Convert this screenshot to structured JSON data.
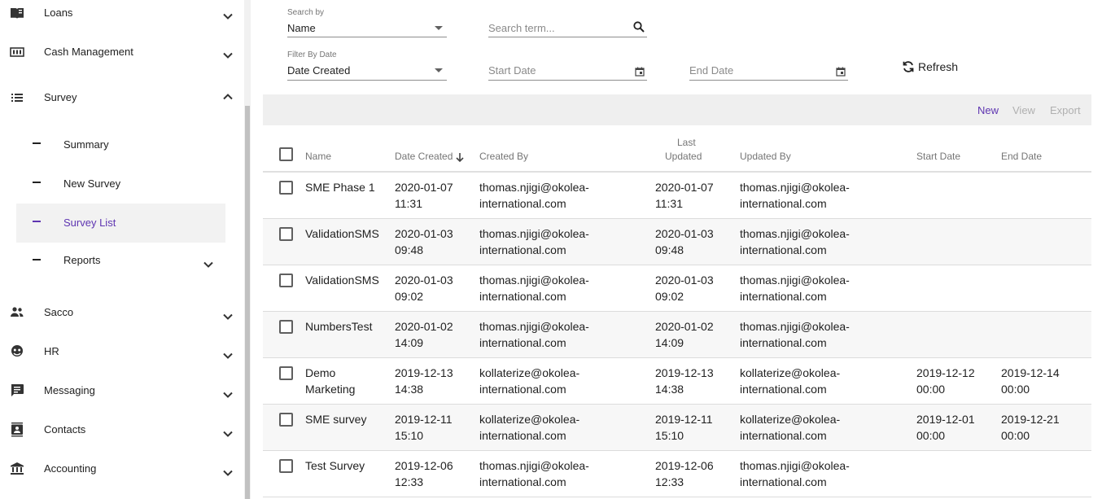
{
  "sidebar": {
    "items": [
      {
        "name": "loans",
        "label": "Loans",
        "icon": "book-icon",
        "expanded": false
      },
      {
        "name": "cash-management",
        "label": "Cash Management",
        "icon": "money-icon",
        "expanded": false
      },
      {
        "name": "survey",
        "label": "Survey",
        "icon": "list-icon",
        "expanded": true
      },
      {
        "name": "sacco",
        "label": "Sacco",
        "icon": "people-icon",
        "expanded": false
      },
      {
        "name": "hr",
        "label": "HR",
        "icon": "face-icon",
        "expanded": false
      },
      {
        "name": "messaging",
        "label": "Messaging",
        "icon": "message-icon",
        "expanded": false
      },
      {
        "name": "contacts",
        "label": "Contacts",
        "icon": "contacts-icon",
        "expanded": false
      },
      {
        "name": "accounting",
        "label": "Accounting",
        "icon": "bank-icon",
        "expanded": false
      }
    ],
    "survey_sub": [
      {
        "label": "Summary",
        "active": false
      },
      {
        "label": "New Survey",
        "active": false
      },
      {
        "label": "Survey List",
        "active": true
      },
      {
        "label": "Reports",
        "active": false,
        "has_children": true
      }
    ]
  },
  "filters": {
    "search_by_label": "Search by",
    "search_by_value": "Name",
    "search_placeholder": "Search term...",
    "filter_by_date_label": "Filter By Date",
    "filter_by_date_value": "Date Created",
    "start_date_placeholder": "Start Date",
    "end_date_placeholder": "End Date",
    "refresh_label": "Refresh"
  },
  "toolbar": {
    "new_label": "New",
    "view_label": "View",
    "export_label": "Export"
  },
  "table": {
    "headers": {
      "name": "Name",
      "date_created": "Date Created",
      "created_by": "Created By",
      "last_updated_1": "Last",
      "last_updated_2": "Updated",
      "updated_by": "Updated By",
      "start_date": "Start Date",
      "end_date": "End Date"
    },
    "rows": [
      {
        "name": [
          "SME Phase 1",
          ""
        ],
        "date_created": [
          "2020-01-07",
          "11:31"
        ],
        "created_by": [
          "thomas.njigi@okolea-",
          "international.com"
        ],
        "last_updated": [
          "2020-01-07",
          "11:31"
        ],
        "updated_by": [
          "thomas.njigi@okolea-",
          "international.com"
        ],
        "start_date": [
          "",
          ""
        ],
        "end_date": [
          "",
          ""
        ]
      },
      {
        "name": [
          "ValidationSMS",
          ""
        ],
        "date_created": [
          "2020-01-03",
          "09:48"
        ],
        "created_by": [
          "thomas.njigi@okolea-",
          "international.com"
        ],
        "last_updated": [
          "2020-01-03",
          "09:48"
        ],
        "updated_by": [
          "thomas.njigi@okolea-",
          "international.com"
        ],
        "start_date": [
          "",
          ""
        ],
        "end_date": [
          "",
          ""
        ]
      },
      {
        "name": [
          "ValidationSMS",
          ""
        ],
        "date_created": [
          "2020-01-03",
          "09:02"
        ],
        "created_by": [
          "thomas.njigi@okolea-",
          "international.com"
        ],
        "last_updated": [
          "2020-01-03",
          "09:02"
        ],
        "updated_by": [
          "thomas.njigi@okolea-",
          "international.com"
        ],
        "start_date": [
          "",
          ""
        ],
        "end_date": [
          "",
          ""
        ]
      },
      {
        "name": [
          "NumbersTest",
          ""
        ],
        "date_created": [
          "2020-01-02",
          "14:09"
        ],
        "created_by": [
          "thomas.njigi@okolea-",
          "international.com"
        ],
        "last_updated": [
          "2020-01-02",
          "14:09"
        ],
        "updated_by": [
          "thomas.njigi@okolea-",
          "international.com"
        ],
        "start_date": [
          "",
          ""
        ],
        "end_date": [
          "",
          ""
        ]
      },
      {
        "name": [
          "Demo",
          "Marketing"
        ],
        "date_created": [
          "2019-12-13",
          "14:38"
        ],
        "created_by": [
          "kollaterize@okolea-",
          "international.com"
        ],
        "last_updated": [
          "2019-12-13",
          "14:38"
        ],
        "updated_by": [
          "kollaterize@okolea-",
          "international.com"
        ],
        "start_date": [
          "2019-12-12",
          "00:00"
        ],
        "end_date": [
          "2019-12-14",
          "00:00"
        ]
      },
      {
        "name": [
          "SME survey",
          ""
        ],
        "date_created": [
          "2019-12-11",
          "15:10"
        ],
        "created_by": [
          "kollaterize@okolea-",
          "international.com"
        ],
        "last_updated": [
          "2019-12-11",
          "15:10"
        ],
        "updated_by": [
          "kollaterize@okolea-",
          "international.com"
        ],
        "start_date": [
          "2019-12-01",
          "00:00"
        ],
        "end_date": [
          "2019-12-21",
          "00:00"
        ]
      },
      {
        "name": [
          "Test Survey",
          ""
        ],
        "date_created": [
          "2019-12-06",
          "12:33"
        ],
        "created_by": [
          "thomas.njigi@okolea-",
          "international.com"
        ],
        "last_updated": [
          "2019-12-06",
          "12:33"
        ],
        "updated_by": [
          "thomas.njigi@okolea-",
          "international.com"
        ],
        "start_date": [
          "",
          ""
        ],
        "end_date": [
          "",
          ""
        ]
      }
    ]
  },
  "colors": {
    "accent": "#5e35b1",
    "toolbar_bg": "#efefef",
    "active_bg": "#f2f2f2"
  }
}
